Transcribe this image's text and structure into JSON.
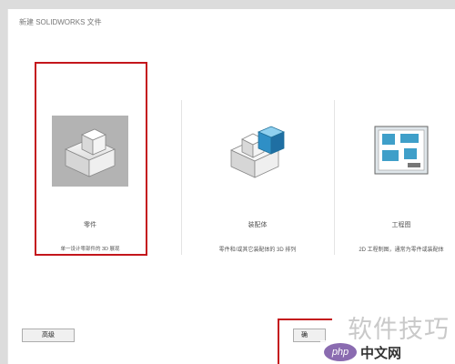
{
  "window": {
    "title": "新建 SOLIDWORKS 文件"
  },
  "options": [
    {
      "label": "零件",
      "description": "单一设计零部件的 3D 展现",
      "icon": "part-icon",
      "selected": true
    },
    {
      "label": "装配体",
      "description": "零件和/或其它装配体的 3D 排列",
      "icon": "assembly-icon",
      "selected": false
    },
    {
      "label": "工程图",
      "description": "2D 工程制图，通常为零件或装配体",
      "icon": "drawing-icon",
      "selected": false
    }
  ],
  "buttons": {
    "advanced_label": "高级",
    "ok_label": "确"
  },
  "watermark": {
    "text": "软件技巧",
    "logo_label": "php",
    "site_label": "中文网"
  },
  "colors": {
    "highlight": "#c4161c",
    "selected_bg": "#b3b3b3",
    "assembly_accent": "#2f8fc6",
    "drawing_accent": "#3f9fc9"
  }
}
